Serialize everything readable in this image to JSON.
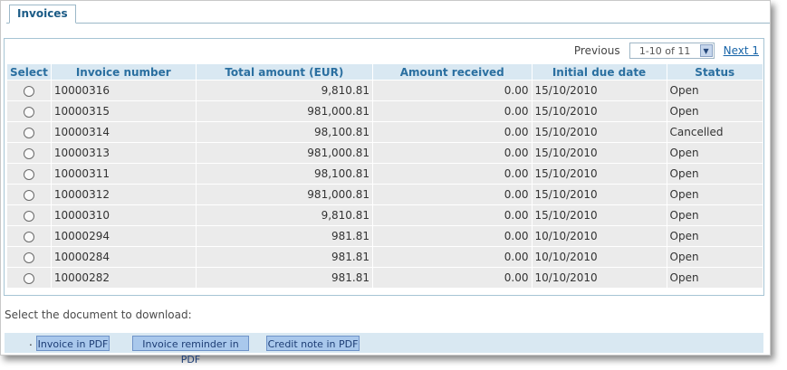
{
  "tab": {
    "label": "Invoices"
  },
  "pager": {
    "previous_label": "Previous",
    "range_value": "1-10 of 11",
    "next_label": "Next 1"
  },
  "table": {
    "headers": [
      "Select",
      "Invoice number",
      "Total amount (EUR)",
      "Amount received",
      "Initial due date",
      "Status"
    ],
    "rows": [
      {
        "invoice": "10000316",
        "total": "9,810.81",
        "received": "0.00",
        "due": "15/10/2010",
        "status": "Open"
      },
      {
        "invoice": "10000315",
        "total": "981,000.81",
        "received": "0.00",
        "due": "15/10/2010",
        "status": "Open"
      },
      {
        "invoice": "10000314",
        "total": "98,100.81",
        "received": "0.00",
        "due": "15/10/2010",
        "status": "Cancelled"
      },
      {
        "invoice": "10000313",
        "total": "981,000.81",
        "received": "0.00",
        "due": "15/10/2010",
        "status": "Open"
      },
      {
        "invoice": "10000311",
        "total": "98,100.81",
        "received": "0.00",
        "due": "15/10/2010",
        "status": "Open"
      },
      {
        "invoice": "10000312",
        "total": "981,000.81",
        "received": "0.00",
        "due": "15/10/2010",
        "status": "Open"
      },
      {
        "invoice": "10000310",
        "total": "9,810.81",
        "received": "0.00",
        "due": "15/10/2010",
        "status": "Open"
      },
      {
        "invoice": "10000294",
        "total": "981.81",
        "received": "0.00",
        "due": "10/10/2010",
        "status": "Open"
      },
      {
        "invoice": "10000284",
        "total": "981.81",
        "received": "0.00",
        "due": "10/10/2010",
        "status": "Open"
      },
      {
        "invoice": "10000282",
        "total": "981.81",
        "received": "0.00",
        "due": "10/10/2010",
        "status": "Open"
      }
    ]
  },
  "instruction": "Select the document to download:",
  "buttons": {
    "invoice_pdf": "Invoice in PDF",
    "reminder_pdf": "Invoice reminder in PDF",
    "credit_note_pdf": "Credit note in PDF"
  },
  "icons": {
    "select_arrow": "chevron-down-icon",
    "radio": "radio-icon"
  },
  "colors": {
    "header_bg": "#d9e8f2",
    "header_text": "#2a6fa0",
    "row_bg": "#ebebeb",
    "button_bg": "#a9c8ec",
    "link": "#1764a8"
  }
}
